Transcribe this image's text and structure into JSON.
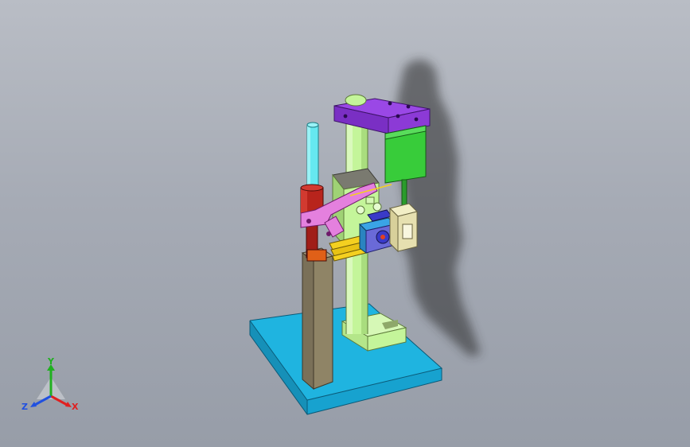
{
  "viewport": {
    "background_top": "#b9bdc5",
    "background_bottom": "#979da8"
  },
  "model": {
    "parts": [
      {
        "name": "base-plate",
        "color": "#1fb4e0"
      },
      {
        "name": "column",
        "color": "#c4f59a"
      },
      {
        "name": "column-foot-clamp",
        "color": "#c4f59a"
      },
      {
        "name": "top-bracket",
        "color": "#9a48e6"
      },
      {
        "name": "motor-block",
        "color": "#38cc3a"
      },
      {
        "name": "rod",
        "color": "#66e8f0"
      },
      {
        "name": "cylinder",
        "color": "#b8241c"
      },
      {
        "name": "post",
        "color": "#8f8466"
      },
      {
        "name": "linkage-arm",
        "color": "#e480de"
      },
      {
        "name": "slide-rails",
        "color": "#f4d020"
      },
      {
        "name": "slide-carriage",
        "color": "#3aa4e6"
      },
      {
        "name": "gear-housing",
        "color": "#f2eec6"
      },
      {
        "name": "shadow",
        "color": "#2b2b2b"
      }
    ]
  },
  "triad": {
    "x_label": "X",
    "y_label": "Y",
    "z_label": "Z",
    "x_color": "#e02020",
    "y_color": "#20b020",
    "z_color": "#2050e0"
  }
}
